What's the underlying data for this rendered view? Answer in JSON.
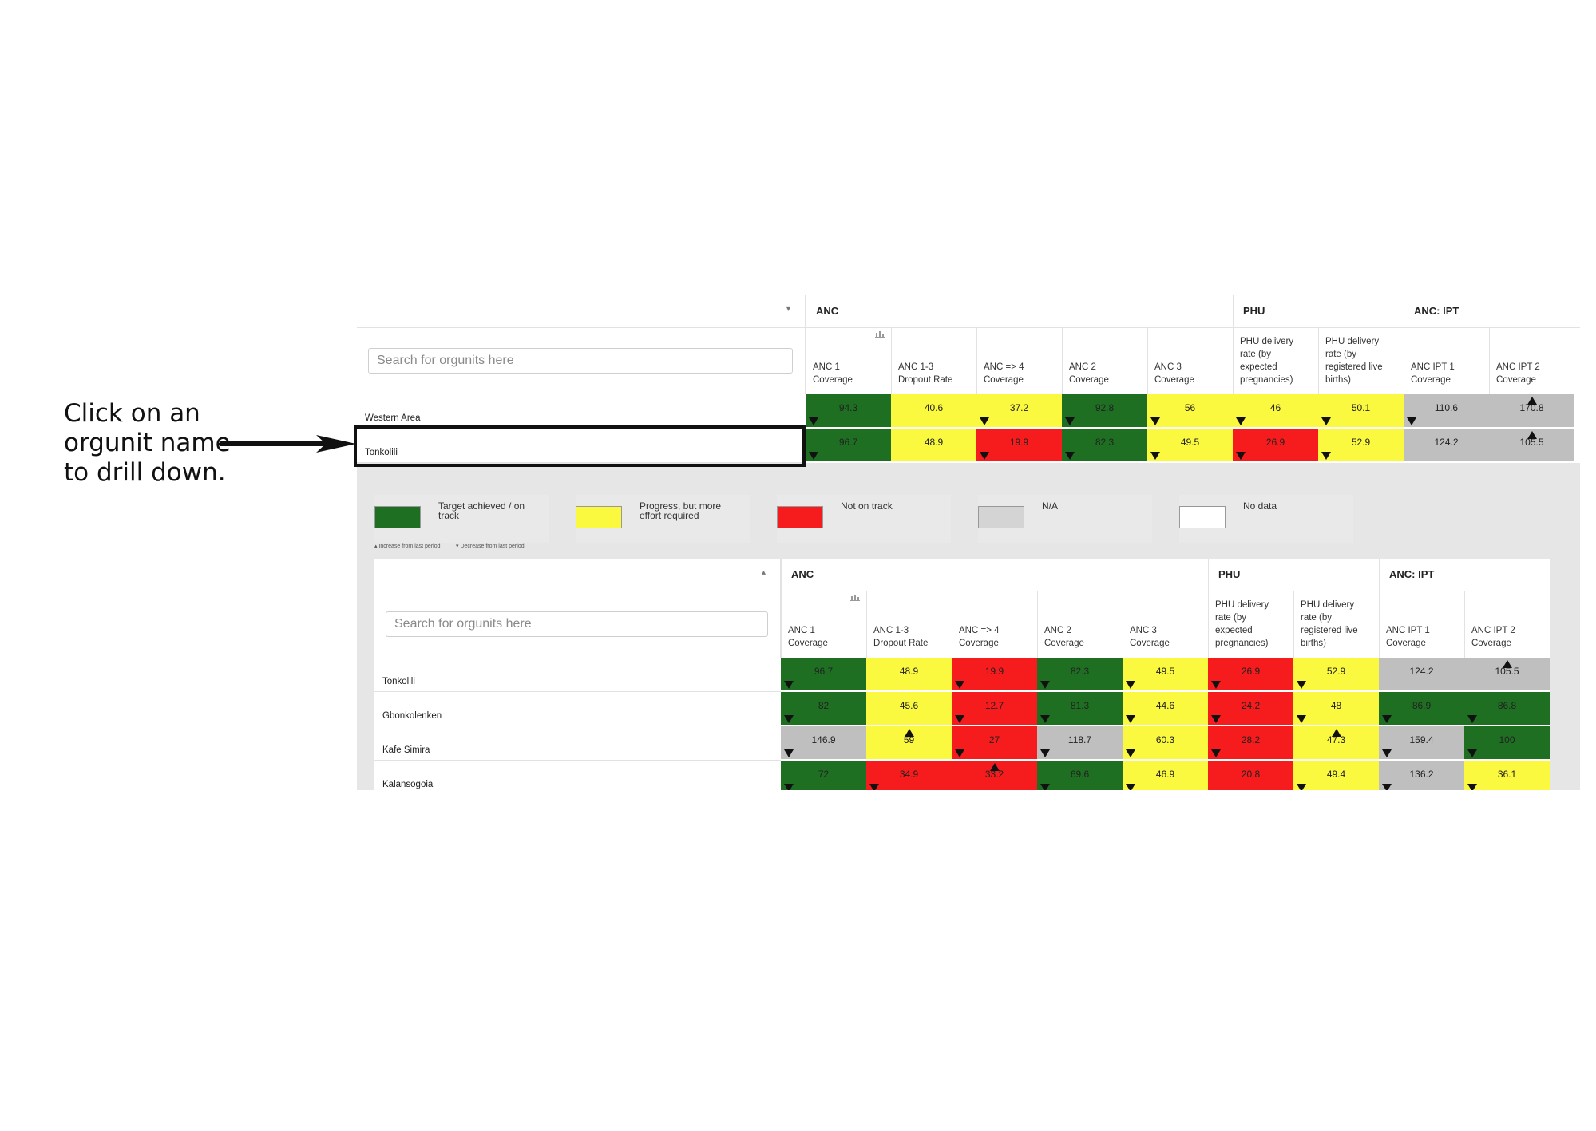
{
  "annotation": {
    "lines": [
      "Click on an",
      "orgunit name",
      "to drill down."
    ]
  },
  "top_table": {
    "sort_indicator": "▾",
    "search_placeholder": "Search for orgunits here",
    "groups": [
      "ANC",
      "PHU",
      "ANC: IPT"
    ],
    "columns": [
      [
        "ANC 1",
        "Coverage"
      ],
      [
        "ANC 1-3",
        "Dropout Rate"
      ],
      [
        "ANC => 4",
        "Coverage"
      ],
      [
        "ANC 2",
        "Coverage"
      ],
      [
        "ANC 3",
        "Coverage"
      ],
      [
        "PHU delivery",
        "rate (by",
        "expected",
        "pregnancies)"
      ],
      [
        "PHU delivery",
        "rate (by",
        "registered live",
        "births)"
      ],
      [
        "ANC IPT 1",
        "Coverage"
      ],
      [
        "ANC IPT 2",
        "Coverage"
      ]
    ],
    "rows": [
      {
        "name": "Western Area",
        "cells": [
          {
            "v": "94.3",
            "c": "g",
            "t": "down"
          },
          {
            "v": "40.6",
            "c": "y",
            "t": ""
          },
          {
            "v": "37.2",
            "c": "y",
            "t": "down"
          },
          {
            "v": "92.8",
            "c": "g",
            "t": "down"
          },
          {
            "v": "56",
            "c": "y",
            "t": "down"
          },
          {
            "v": "46",
            "c": "y",
            "t": "down"
          },
          {
            "v": "50.1",
            "c": "y",
            "t": "down"
          },
          {
            "v": "110.6",
            "c": "n",
            "t": "down"
          },
          {
            "v": "170.8",
            "c": "n",
            "t": "up"
          }
        ]
      },
      {
        "name": "Tonkolili",
        "cells": [
          {
            "v": "96.7",
            "c": "g",
            "t": "down"
          },
          {
            "v": "48.9",
            "c": "y",
            "t": ""
          },
          {
            "v": "19.9",
            "c": "r",
            "t": "down"
          },
          {
            "v": "82.3",
            "c": "g",
            "t": "down"
          },
          {
            "v": "49.5",
            "c": "y",
            "t": "down"
          },
          {
            "v": "26.9",
            "c": "r",
            "t": "down"
          },
          {
            "v": "52.9",
            "c": "y",
            "t": "down"
          },
          {
            "v": "124.2",
            "c": "n",
            "t": ""
          },
          {
            "v": "105.5",
            "c": "n",
            "t": "up"
          }
        ]
      }
    ]
  },
  "legend": {
    "items": [
      {
        "label": "Target achieved / on track",
        "color": "#1f6f23"
      },
      {
        "label": "Progress, but more effort required",
        "color": "#fbf93f"
      },
      {
        "label": "Not on track",
        "color": "#f61b1c"
      },
      {
        "label": "N/A",
        "color": "#d4d4d4"
      },
      {
        "label": "No data",
        "color": "#ffffff"
      }
    ],
    "footnote_increase": "▴ Increase from last period",
    "footnote_decrease": "▾ Decrease from last period"
  },
  "bottom_table": {
    "sort_indicator": "▴",
    "search_placeholder": "Search for orgunits here",
    "groups": [
      "ANC",
      "PHU",
      "ANC: IPT"
    ],
    "columns": [
      [
        "ANC 1",
        "Coverage"
      ],
      [
        "ANC 1-3",
        "Dropout Rate"
      ],
      [
        "ANC => 4",
        "Coverage"
      ],
      [
        "ANC 2",
        "Coverage"
      ],
      [
        "ANC 3",
        "Coverage"
      ],
      [
        "PHU delivery",
        "rate (by",
        "expected",
        "pregnancies)"
      ],
      [
        "PHU delivery",
        "rate (by",
        "registered live",
        "births)"
      ],
      [
        "ANC IPT 1",
        "Coverage"
      ],
      [
        "ANC IPT 2",
        "Coverage"
      ]
    ],
    "rows": [
      {
        "name": "Tonkolili",
        "cells": [
          {
            "v": "96.7",
            "c": "g",
            "t": "down"
          },
          {
            "v": "48.9",
            "c": "y",
            "t": ""
          },
          {
            "v": "19.9",
            "c": "r",
            "t": "down"
          },
          {
            "v": "82.3",
            "c": "g",
            "t": "down"
          },
          {
            "v": "49.5",
            "c": "y",
            "t": "down"
          },
          {
            "v": "26.9",
            "c": "r",
            "t": "down"
          },
          {
            "v": "52.9",
            "c": "y",
            "t": "down"
          },
          {
            "v": "124.2",
            "c": "n",
            "t": ""
          },
          {
            "v": "105.5",
            "c": "n",
            "t": "up"
          }
        ]
      },
      {
        "name": "Gbonkolenken",
        "cells": [
          {
            "v": "82",
            "c": "g",
            "t": "down"
          },
          {
            "v": "45.6",
            "c": "y",
            "t": ""
          },
          {
            "v": "12.7",
            "c": "r",
            "t": "down"
          },
          {
            "v": "81.3",
            "c": "g",
            "t": "down"
          },
          {
            "v": "44.6",
            "c": "y",
            "t": "down"
          },
          {
            "v": "24.2",
            "c": "r",
            "t": "down"
          },
          {
            "v": "48",
            "c": "y",
            "t": "down"
          },
          {
            "v": "86.9",
            "c": "g",
            "t": "down"
          },
          {
            "v": "86.8",
            "c": "g",
            "t": "down"
          }
        ]
      },
      {
        "name": "Kafe Simira",
        "cells": [
          {
            "v": "146.9",
            "c": "n",
            "t": "down"
          },
          {
            "v": "59",
            "c": "y",
            "t": "up"
          },
          {
            "v": "27",
            "c": "r",
            "t": "down"
          },
          {
            "v": "118.7",
            "c": "n",
            "t": "down"
          },
          {
            "v": "60.3",
            "c": "y",
            "t": "down"
          },
          {
            "v": "28.2",
            "c": "r",
            "t": "down"
          },
          {
            "v": "47.3",
            "c": "y",
            "t": "up"
          },
          {
            "v": "159.4",
            "c": "n",
            "t": "down"
          },
          {
            "v": "100",
            "c": "g",
            "t": "down"
          }
        ]
      },
      {
        "name": "Kalansogoia",
        "cells": [
          {
            "v": "72",
            "c": "g",
            "t": "down"
          },
          {
            "v": "34.9",
            "c": "r",
            "t": "down"
          },
          {
            "v": "33.2",
            "c": "r",
            "t": "up"
          },
          {
            "v": "69.6",
            "c": "g",
            "t": "down"
          },
          {
            "v": "46.9",
            "c": "y",
            "t": "down"
          },
          {
            "v": "20.8",
            "c": "r",
            "t": ""
          },
          {
            "v": "49.4",
            "c": "y",
            "t": "down"
          },
          {
            "v": "136.2",
            "c": "n",
            "t": "down"
          },
          {
            "v": "36.1",
            "c": "y",
            "t": "down"
          }
        ]
      }
    ]
  }
}
